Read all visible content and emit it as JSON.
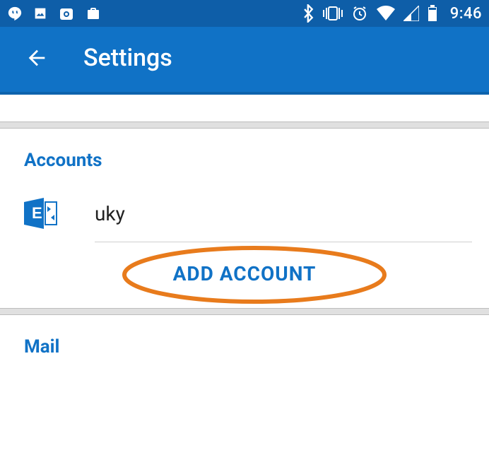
{
  "status_bar": {
    "clock": "9:46"
  },
  "app_bar": {
    "title": "Settings"
  },
  "sections": {
    "accounts_header": "Accounts",
    "mail_header": "Mail",
    "account_name": "uky",
    "add_account_label": "ADD ACCOUNT"
  },
  "colors": {
    "brand_blue": "#1072c6",
    "status_blue": "#0e5ea8",
    "annotation": "#e87b1c"
  }
}
